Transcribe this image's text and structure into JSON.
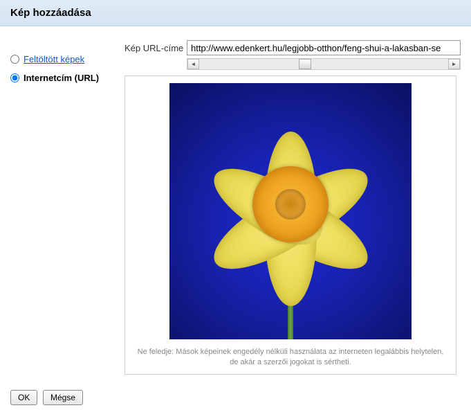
{
  "header": {
    "title": "Kép hozzáadása"
  },
  "sidebar": {
    "options": [
      {
        "label": "Feltöltött képek",
        "selected": false
      },
      {
        "label": "Internetcím (URL)",
        "selected": true
      }
    ]
  },
  "url_section": {
    "label": "Kép URL-címe",
    "value": "http://www.edenkert.hu/legjobb-otthon/feng-shui-a-lakasban-se"
  },
  "disclaimer": "Ne feledje: Mások képeinek engedély nélküli használata az interneten legalábbis helytelen, de akár a szerzői jogokat is sértheti.",
  "footer": {
    "ok": "OK",
    "cancel": "Mégse"
  },
  "preview": {
    "description": "yellow-daffodil-flower-on-blue-background"
  }
}
